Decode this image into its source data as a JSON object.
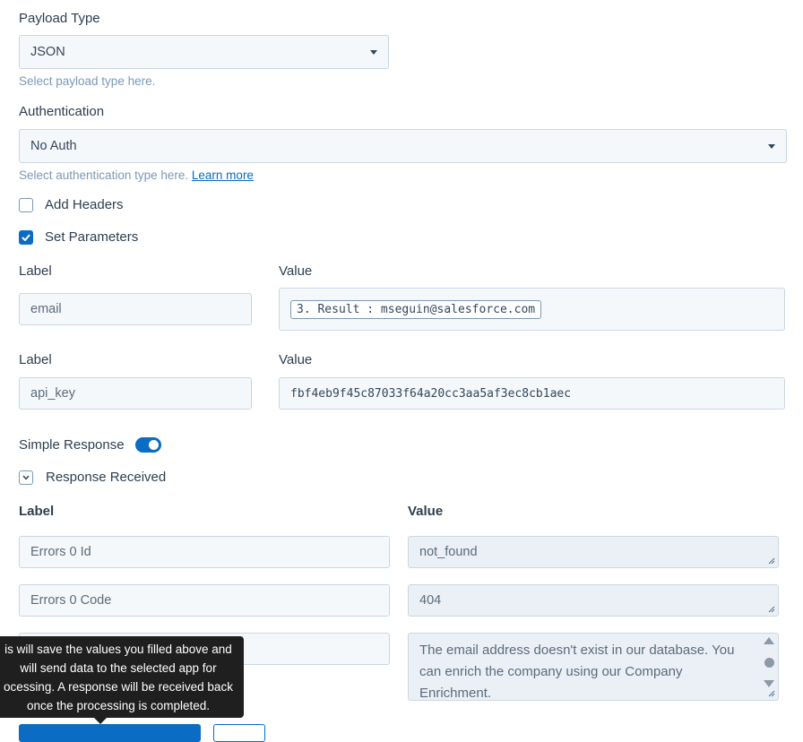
{
  "payload": {
    "label": "Payload Type",
    "value": "JSON",
    "help": "Select payload type here."
  },
  "auth": {
    "label": "Authentication",
    "value": "No Auth",
    "help": "Select authentication type here.",
    "learn_more": "Learn more"
  },
  "options": {
    "add_headers": "Add Headers",
    "set_parameters": "Set Parameters"
  },
  "params": [
    {
      "label_header": "Label",
      "value_header": "Value",
      "label": "email",
      "value": "3. Result : mseguin@salesforce.com"
    },
    {
      "label_header": "Label",
      "value_header": "Value",
      "label": "api_key",
      "value": "fbf4eb9f45c87033f64a20cc3aa5af3ec8cb1aec"
    }
  ],
  "simple_response": {
    "label": "Simple Response",
    "enabled": true
  },
  "response_received": {
    "label": "Response Received",
    "label_header": "Label",
    "value_header": "Value",
    "rows": [
      {
        "label": "Errors 0 Id",
        "value": "not_found"
      },
      {
        "label": "Errors 0 Code",
        "value": "404"
      },
      {
        "label": "",
        "value": "The email address doesn't exist in our database. You can enrich the company using our Company Enrichment."
      }
    ]
  },
  "tooltip": {
    "lines": [
      "is will save the values you filled above and",
      "will send data to the selected app for",
      "ocessing. A response will be received back",
      "once the processing is completed."
    ]
  },
  "colors": {
    "accent": "#0a6cc2",
    "text": "#33475b",
    "field_bg": "#f5f8fa",
    "readonly_bg": "#eaf0f6",
    "tooltip_bg": "#1f1f1f"
  }
}
